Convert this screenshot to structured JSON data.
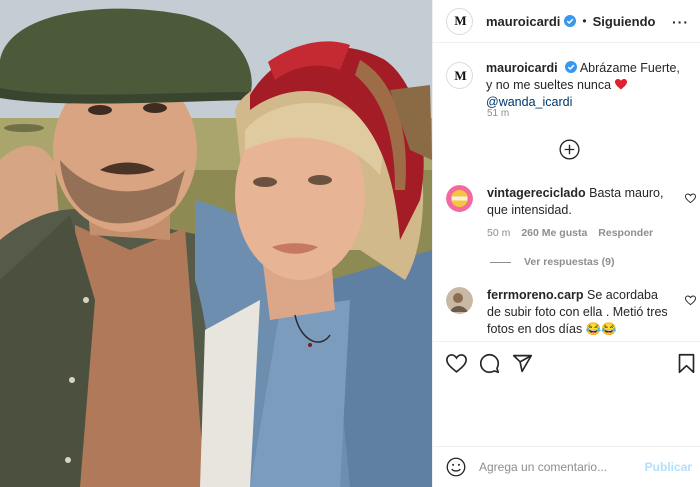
{
  "post": {
    "author": "mauroicardi",
    "verified": true,
    "separator": "•",
    "follow_label": "Siguiendo",
    "more_label": "···",
    "avatar_monogram": "M"
  },
  "caption": {
    "username": "mauroicardi",
    "text": "Abrázame Fuerte, y no me sueltes nunca",
    "heart": "❤",
    "mention": "@wanda_icardi",
    "time": "51 m"
  },
  "comments": [
    {
      "username": "vintagereciclado",
      "text": "Basta mauro, que intensidad.",
      "time": "50 m",
      "likes": "260 Me gusta",
      "reply_label": "Responder",
      "replies_label": "Ver respuestas (9)",
      "avatar_text": "VINTAGE RECICLADO"
    },
    {
      "username": "ferrmoreno.carp",
      "text": "Se acordaba de subir foto con ella . Metió tres fotos en dos días 😂😂"
    }
  ],
  "composer": {
    "placeholder": "Agrega un comentario...",
    "publish_label": "Publicar"
  },
  "icons": {
    "verified": "verified-badge-icon",
    "load_more": "plus-circle-icon",
    "like": "heart-icon",
    "comment": "comment-icon",
    "share": "send-icon",
    "save": "bookmark-icon",
    "emoji": "emoji-icon"
  },
  "colors": {
    "verified_blue": "#3897f0",
    "mention": "#00376b",
    "muted": "#8e8e8e",
    "heart_red": "#ed4956",
    "publish_disabled": "#b2dffc"
  }
}
